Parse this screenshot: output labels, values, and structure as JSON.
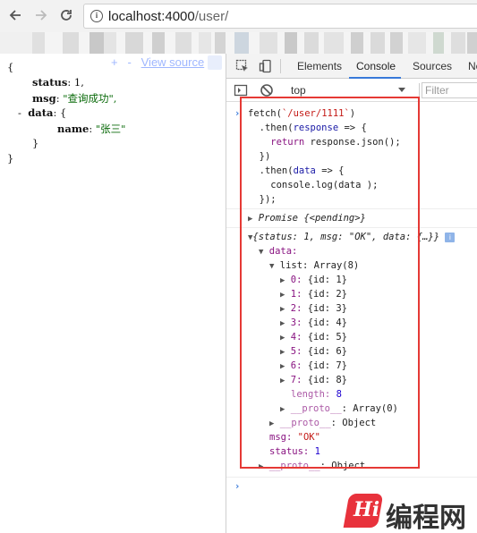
{
  "browser": {
    "url_host": "localhost:4000",
    "url_path": "/user/"
  },
  "page": {
    "view_source": {
      "plus": "+",
      "minus": "-",
      "label": "View source"
    },
    "json_lines": {
      "open": "{",
      "status_key": "status",
      "status_val": "1,",
      "msg_key": "msg",
      "msg_val": "\"查询成功\",",
      "toggle": "-",
      "data_key": "data",
      "data_open": "{",
      "name_key": "name",
      "name_val": "\"张三\"",
      "data_close": "}",
      "close": "}"
    }
  },
  "devtools": {
    "tabs": [
      "Elements",
      "Console",
      "Sources",
      "Ne"
    ],
    "context": "top",
    "filter_placeholder": "Filter",
    "console": {
      "code": [
        "fetch(`/user/1111`)",
        "  .then(response => {",
        "    return response.json();",
        "  })",
        "  .then(data => {",
        "    console.log(data );",
        "  });"
      ],
      "promise": "Promise {<pending>}",
      "object_summary": "{status: 1, msg: \"OK\", data: {…}}",
      "data_label": "data:",
      "list_label": "list: Array(8)",
      "items": [
        {
          "idx": "0:",
          "val": "{id: 1}"
        },
        {
          "idx": "1:",
          "val": "{id: 2}"
        },
        {
          "idx": "2:",
          "val": "{id: 3}"
        },
        {
          "idx": "3:",
          "val": "{id: 4}"
        },
        {
          "idx": "4:",
          "val": "{id: 5}"
        },
        {
          "idx": "5:",
          "val": "{id: 6}"
        },
        {
          "idx": "6:",
          "val": "{id: 7}"
        },
        {
          "idx": "7:",
          "val": "{id: 8}"
        }
      ],
      "length_key": "length:",
      "length_val": "8",
      "proto_array": "__proto__",
      "proto_array_val": ": Array(0)",
      "proto_obj_1": "__proto__",
      "proto_obj_1_val": ": Object",
      "msg_key": "msg:",
      "msg_val": "\"OK\"",
      "status_key": "status:",
      "status_val": "1",
      "proto_obj_2": "__proto__",
      "proto_obj_2_val": ": Object"
    }
  },
  "watermark": {
    "logo": "Hi",
    "text": "编程网"
  },
  "colors": {
    "accent_red": "#e53935",
    "tab_underline": "#3879d9",
    "json_string": "#0b6b0b"
  }
}
